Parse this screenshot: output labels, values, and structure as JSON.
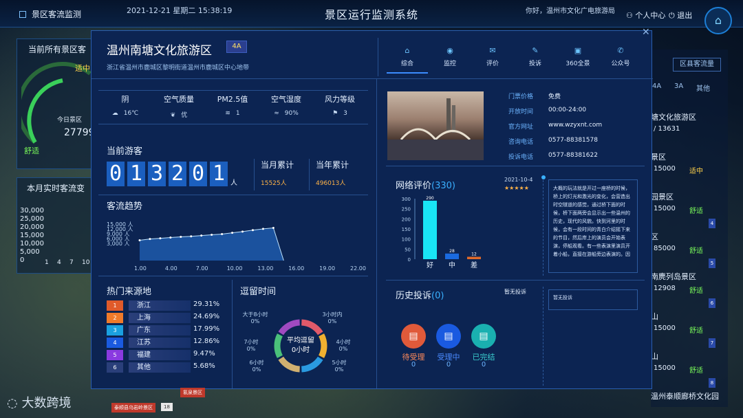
{
  "topbar": {
    "module": "景区客流监测",
    "date": "2021-12-21 星期二 15:38:19",
    "title": "景区运行监测系统",
    "greet": "你好，温州市文化广电旅游局",
    "user": "个人中心",
    "exit": "退出"
  },
  "left": {
    "panel1_title": "当前所有景区客",
    "status_mid": "适中",
    "today_label": "今日景区",
    "today_value": "27799",
    "comfort": "舒适",
    "panel2_title": "本月实时客流变",
    "y_ticks": [
      "30,000",
      "25,000",
      "20,000",
      "15,000",
      "10,000",
      "5,000",
      "0"
    ],
    "x_ticks": [
      "1",
      "4",
      "7",
      "10"
    ]
  },
  "right": {
    "tab_flow": "区县客流量",
    "levels": [
      "4A",
      "3A",
      "其他"
    ],
    "cards": [
      {
        "name": "塘文化旅游区",
        "value": "/ 13631",
        "status": "",
        "status_color": "#ff5555"
      },
      {
        "name": "景区",
        "value": "15000",
        "status": "适中",
        "status_color": "#ffd24a"
      },
      {
        "name": "园景区",
        "value": "15000",
        "status": "舒适",
        "status_color": "#7cff5a"
      },
      {
        "name": "区",
        "value": "85000",
        "status": "舒适",
        "status_color": "#7cff5a"
      },
      {
        "name": "南麂列岛景区",
        "value": "12908",
        "status": "舒适",
        "status_color": "#7cff5a"
      },
      {
        "name": "山",
        "value": "15000",
        "status": "舒适",
        "status_color": "#7cff5a"
      },
      {
        "name": "山",
        "value": "15000",
        "status": "舒适",
        "status_color": "#7cff5a"
      },
      {
        "name": "温州泰顺廊桥文化园",
        "value": "",
        "status": "",
        "status_color": "#7cff5a"
      }
    ],
    "ranks": [
      "4",
      "5",
      "6",
      "7",
      "8"
    ]
  },
  "modal": {
    "name": "温州南塘文化旅游区",
    "level": "4A",
    "address": "浙江省温州市鹿城区黎明街道温州市鹿城区中心地带",
    "tabs": [
      {
        "label": "综合",
        "icon": "home-icon"
      },
      {
        "label": "监控",
        "icon": "camera-icon"
      },
      {
        "label": "评价",
        "icon": "chat-icon"
      },
      {
        "label": "投诉",
        "icon": "edit-icon"
      },
      {
        "label": "360全景",
        "icon": "panorama-icon"
      },
      {
        "label": "公众号",
        "icon": "wechat-icon"
      }
    ],
    "weather": [
      {
        "h": "阴",
        "v": "16℃",
        "icon": "☁"
      },
      {
        "h": "空气质量",
        "v": "优",
        "icon": "❦"
      },
      {
        "h": "PM2.5值",
        "v": "1",
        "icon": "≋"
      },
      {
        "h": "空气湿度",
        "v": "90%",
        "icon": "≈"
      },
      {
        "h": "风力等级",
        "v": "3",
        "icon": "⚑"
      }
    ],
    "current_title": "当前游客",
    "current_digits": [
      "0",
      "1",
      "3",
      "2",
      "0",
      "1"
    ],
    "unit": "人",
    "month_label": "当月累计",
    "month_value": "15525人",
    "year_label": "当年累计",
    "year_value": "496013人",
    "trend_title": "客流趋势",
    "source_title": "热门来源地",
    "sources": [
      {
        "name": "浙江",
        "pct": "29.31%",
        "color": "#e05a2a"
      },
      {
        "name": "上海",
        "pct": "24.69%",
        "color": "#f07a2a"
      },
      {
        "name": "广东",
        "pct": "17.99%",
        "color": "#1aa0e0"
      },
      {
        "name": "江苏",
        "pct": "12.86%",
        "color": "#1a5ae0"
      },
      {
        "name": "福建",
        "pct": "9.47%",
        "color": "#8a3ae0"
      },
      {
        "name": "其他",
        "pct": "5.68%",
        "color": "#2a3f7a"
      }
    ],
    "source_ranks": [
      "1",
      "2",
      "3",
      "4",
      "5",
      "6"
    ],
    "stay_title": "逗留时间",
    "stay_center1": "平均逗留",
    "stay_center2": "0小时",
    "stay_labels": [
      {
        "t": "大于8小时",
        "v": "0%"
      },
      {
        "t": "3小时内",
        "v": "0%"
      },
      {
        "t": "4小时",
        "v": "0%"
      },
      {
        "t": "5小时",
        "v": "0%"
      },
      {
        "t": "6小时",
        "v": "0%"
      },
      {
        "t": "7小时",
        "v": "0%"
      }
    ],
    "info": [
      {
        "k": "门票价格",
        "v": "免费"
      },
      {
        "k": "开放时间",
        "v": "00:00-24:00"
      },
      {
        "k": "官方网址",
        "v": "www.wzyxnt.com"
      },
      {
        "k": "咨询电话",
        "v": "0577-88381578"
      },
      {
        "k": "投诉电话",
        "v": "0577-88381622"
      }
    ],
    "review_title": "网络评价",
    "review_count": "(330)",
    "review_date": "2021-10-4",
    "review_stars": "★★★★★",
    "review_text": "大概的玩法就是开过一座桥的时候，桥上的灯光和激光的变化，会营造出时空隧道的感觉，通过桥下面的时候，桥下面两旁会显示出一些温州的历史，现代的风貌。快到河里的时候，会有一段时间的青白介绍摇下来的节目，然后岸上的演员会开始表演，停船观看。有一些表演里演员开着小船，直接在游船旁边表演的。因",
    "complaint_title": "历史投诉",
    "complaint_count": "(0)",
    "complaint_none": "暂无投诉",
    "complaint_box": "暂无投诉",
    "complaint_status": [
      {
        "label": "待受理",
        "num": "0",
        "color": "#e05a3a",
        "text_color": "#ff8a5a"
      },
      {
        "label": "受理中",
        "num": "0",
        "color": "#1a5ae0",
        "text_color": "#4a8aff"
      },
      {
        "label": "已完结",
        "num": "0",
        "color": "#1ab0b0",
        "text_color": "#3ad0d0"
      }
    ]
  },
  "bottom": {
    "watermark": "大数跨境",
    "tag1": "泰顺县乌岩岭景区",
    "tag1_num": "18",
    "tag2": "氡泉景区"
  },
  "chart_data": [
    {
      "type": "line",
      "title": "客流趋势",
      "x_ticks": [
        "1.00",
        "4.00",
        "7.00",
        "10.00",
        "13.00",
        "16.00",
        "19.00",
        "22.00"
      ],
      "y_ticks": [
        "15,000 人",
        "12,000 人",
        "9,000 人",
        "6,000 人",
        "3,000 人"
      ],
      "x": [
        1,
        2,
        3,
        4,
        5,
        6,
        7,
        8,
        9,
        10,
        11,
        12,
        13,
        14,
        15
      ],
      "values": [
        8200,
        8700,
        9000,
        9300,
        9600,
        9800,
        10100,
        10400,
        10700,
        11200,
        11700,
        12300,
        12800,
        13201,
        0
      ],
      "xlim": [
        1,
        22
      ],
      "ylim": [
        0,
        15000
      ]
    },
    {
      "type": "bar",
      "title": "网络评价",
      "categories": [
        "好",
        "中",
        "差"
      ],
      "values": [
        290,
        28,
        12
      ],
      "y_ticks": [
        "300",
        "250",
        "200",
        "150",
        "100",
        "50",
        "0"
      ],
      "ylim": [
        0,
        300
      ],
      "colors": [
        "#19e5f5",
        "#1a6ae0",
        "#e06a2a"
      ]
    },
    {
      "type": "pie",
      "title": "逗留时间",
      "colors": [
        "#e05a6a",
        "#f0b030",
        "#2a9ae0",
        "#d0b070",
        "#4ac07a",
        "#a04ac0"
      ]
    }
  ]
}
